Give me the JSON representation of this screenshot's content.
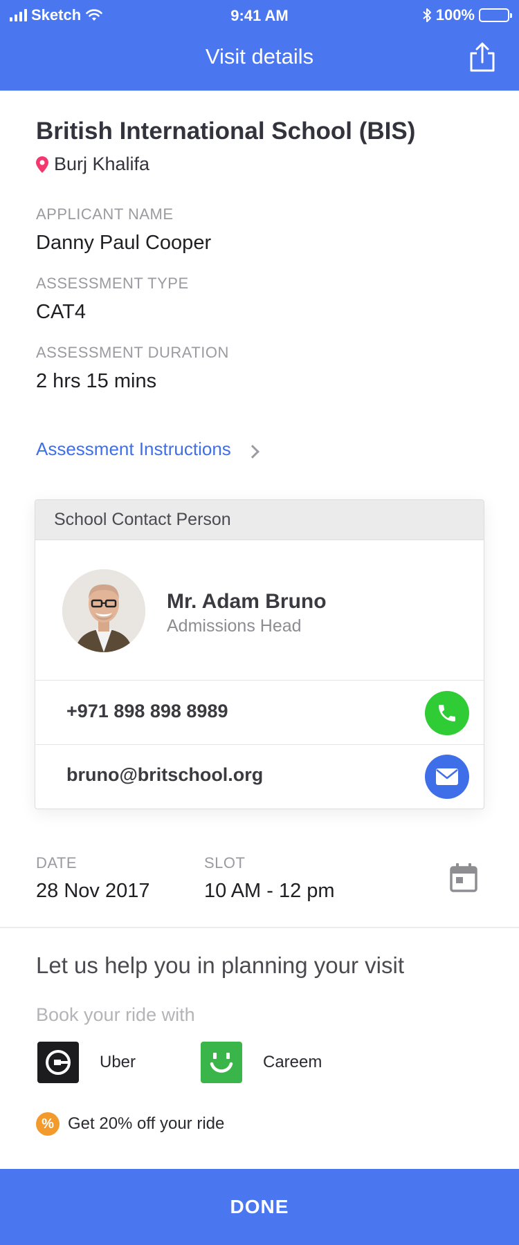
{
  "status_bar": {
    "carrier": "Sketch",
    "time": "9:41 AM",
    "battery": "100%",
    "battery_level": 1.0
  },
  "header": {
    "title": "Visit details",
    "share_icon": "share-icon"
  },
  "school": {
    "name": "British International School (BIS)",
    "location": "Burj Khalifa",
    "location_icon": "map-pin-icon"
  },
  "fields": [
    {
      "label": "APPLICANT NAME",
      "value": "Danny Paul Cooper"
    },
    {
      "label": "ASSESSMENT TYPE",
      "value": "CAT4"
    },
    {
      "label": "ASSESSMENT DURATION",
      "value": "2 hrs 15 mins"
    }
  ],
  "instructions_link": "Assessment Instructions",
  "contact_card": {
    "header": "School Contact Person",
    "name": "Mr. Adam Bruno",
    "role": "Admissions Head",
    "phone": "+971 898 898 8989",
    "email": "bruno@britschool.org",
    "phone_button_color": "#2fcc35",
    "email_button_color": "#3f6fe8"
  },
  "schedule": {
    "date_label": "DATE",
    "date_value": "28 Nov 2017",
    "slot_label": "SLOT",
    "slot_value": "10 AM - 12 pm",
    "calendar_icon": "calendar-icon"
  },
  "planning": {
    "heading": "Let us help you in planning your visit",
    "book_label": "Book your ride with",
    "rides": [
      {
        "name": "Uber",
        "icon": "uber-logo-icon",
        "color": "#1c1c1e"
      },
      {
        "name": "Careem",
        "icon": "careem-logo-icon",
        "color": "#3ab54a"
      }
    ],
    "offer": "Get 20% off your ride",
    "offer_badge": "%"
  },
  "done_label": "DONE",
  "colors": {
    "brand_blue": "#4a76f0",
    "link_blue": "#3f6fe8",
    "offer_orange": "#f39a2c"
  }
}
